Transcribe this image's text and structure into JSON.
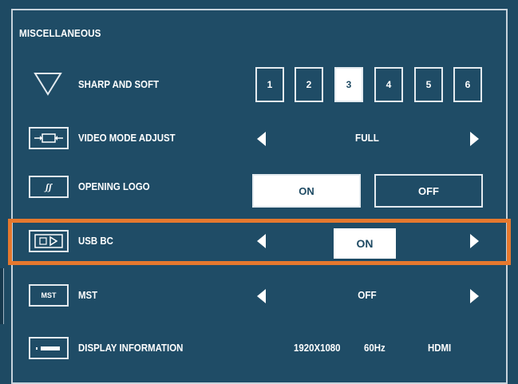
{
  "section": {
    "title": "MISCELLANEOUS"
  },
  "sharp_soft": {
    "label": "SHARP AND SOFT",
    "icon": "triangle-down-icon",
    "options": [
      "1",
      "2",
      "3",
      "4",
      "5",
      "6"
    ],
    "selected": "3"
  },
  "video_mode": {
    "label": "VIDEO MODE ADJUST",
    "icon": "video-mode-icon",
    "value": "FULL"
  },
  "opening_logo": {
    "label": "OPENING LOGO",
    "icon": "logo-icon",
    "on_label": "ON",
    "off_label": "OFF",
    "selected": "ON"
  },
  "usb_bc": {
    "label": "USB BC",
    "icon": "usb-icon",
    "value": "ON"
  },
  "mst": {
    "label": "MST",
    "icon_text": "MST",
    "value": "OFF"
  },
  "display_info": {
    "label": "DISPLAY INFORMATION",
    "icon": "display-info-icon",
    "resolution": "1920X1080",
    "refresh": "60Hz",
    "input": "HDMI"
  },
  "colors": {
    "background": "#1e4a63",
    "highlight": "#e5782e",
    "text": "#ffffff"
  }
}
